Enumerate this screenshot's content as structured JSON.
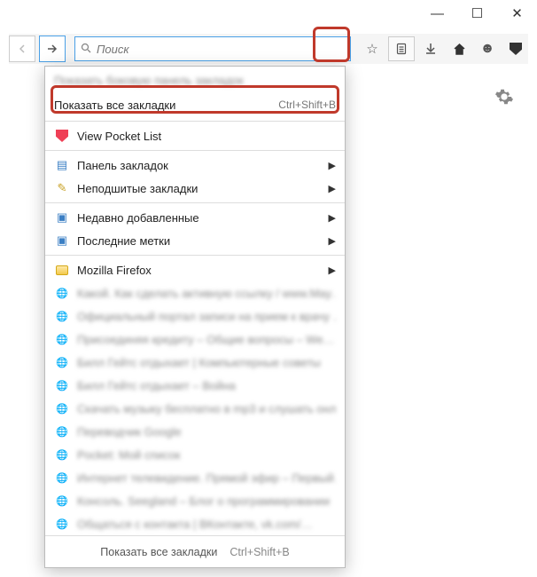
{
  "window": {
    "minimize": "—",
    "maximize": "☐",
    "close": "✕"
  },
  "toolbar": {
    "search_placeholder": "Поиск"
  },
  "menu": {
    "show_sidebar_blurred": "Показать боковую панель закладок",
    "show_all": {
      "label": "Показать все закладки",
      "shortcut": "Ctrl+Shift+B"
    },
    "pocket": "View Pocket List",
    "bookmarks_panel": "Панель закладок",
    "unsorted": "Неподшитые закладки",
    "recent_added": "Недавно добавленные",
    "recent_tags": "Последние метки",
    "firefox_folder": "Mozilla Firefox",
    "blurred_items": [
      "Какой. Как сделать активную ссылку / www.May…",
      "Официальный портал записи на прием к врачу …",
      "Присоединяя кредиту – Общие вопросы – We…",
      "Билл Гейтс отдыхает | Компьютерные советы",
      "Билл Гейтс отдыхает – Война",
      "Скачать музыку бесплатно в mp3 и слушать онл…",
      "Переводчик Google",
      "Pocket: Мой список",
      "Интернет телевидение. Прямой эфир – Первый…",
      "Консоль. Seegland – Блог о программировании",
      "Общаться с контакта | ВКонтакте, vk.com/…"
    ],
    "footer": {
      "label": "Показать все закладки",
      "shortcut": "Ctrl+Shift+B"
    }
  }
}
